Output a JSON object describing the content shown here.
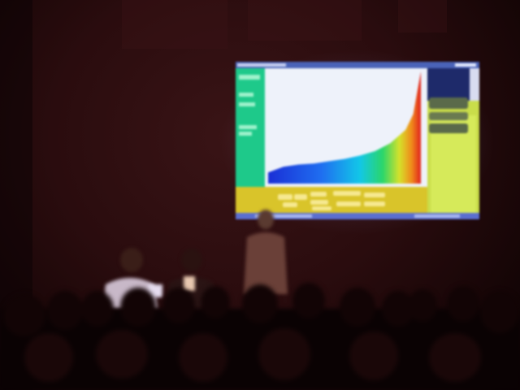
{
  "scene": {
    "description_type": "dim lecture room with projected screen and audience silhouettes",
    "colors": {
      "wall": "#2a0c0e",
      "screen_bg": "#e8eef6",
      "sidebar": "#1ec98a",
      "footer": "#d9c42a",
      "right_panel": "#c9dd4a",
      "titlebar": "#4a63b8"
    }
  },
  "screen": {
    "footer_buttons_count": 10,
    "side_buttons_count": 3
  },
  "chart_data": {
    "type": "area",
    "title": "",
    "xlabel": "",
    "ylabel": "",
    "note_gradient": [
      "#1a2fd6",
      "#1f6ef0",
      "#12c7e8",
      "#2ad66a",
      "#d6e12a",
      "#f08a1a",
      "#e0201e"
    ],
    "x": [
      0,
      10,
      20,
      30,
      40,
      50,
      60,
      70,
      80,
      90,
      95,
      100
    ],
    "values": [
      0.1,
      0.15,
      0.17,
      0.18,
      0.2,
      0.22,
      0.25,
      0.29,
      0.36,
      0.48,
      0.62,
      1.0
    ]
  }
}
